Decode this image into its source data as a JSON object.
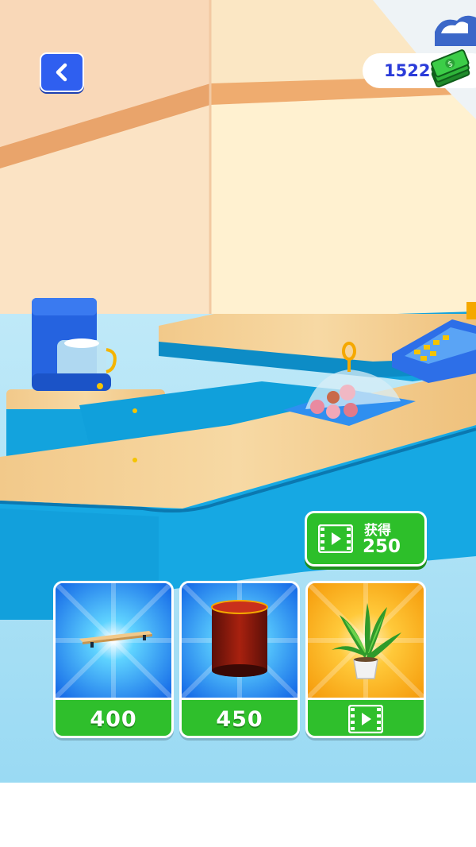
{
  "hud": {
    "back_icon": "chevron-left-icon",
    "money_value": "1522",
    "money_icon": "cash-stack-icon"
  },
  "reward_button": {
    "label": "获得",
    "amount": "250",
    "icon": "video-icon"
  },
  "shop": {
    "items": [
      {
        "name": "shelf",
        "price": "400",
        "background": "#1a8cf2"
      },
      {
        "name": "red-stool",
        "price": "450",
        "background": "#1a8cf2"
      },
      {
        "name": "potted-plant",
        "price_icon": "video-icon",
        "background": "#f5b212"
      }
    ]
  },
  "colors": {
    "accent_green": "#2dbf2a",
    "counter_blue": "#13a3dd",
    "back_button_blue": "#2f5ff0",
    "money_text": "#2b3cd9"
  }
}
